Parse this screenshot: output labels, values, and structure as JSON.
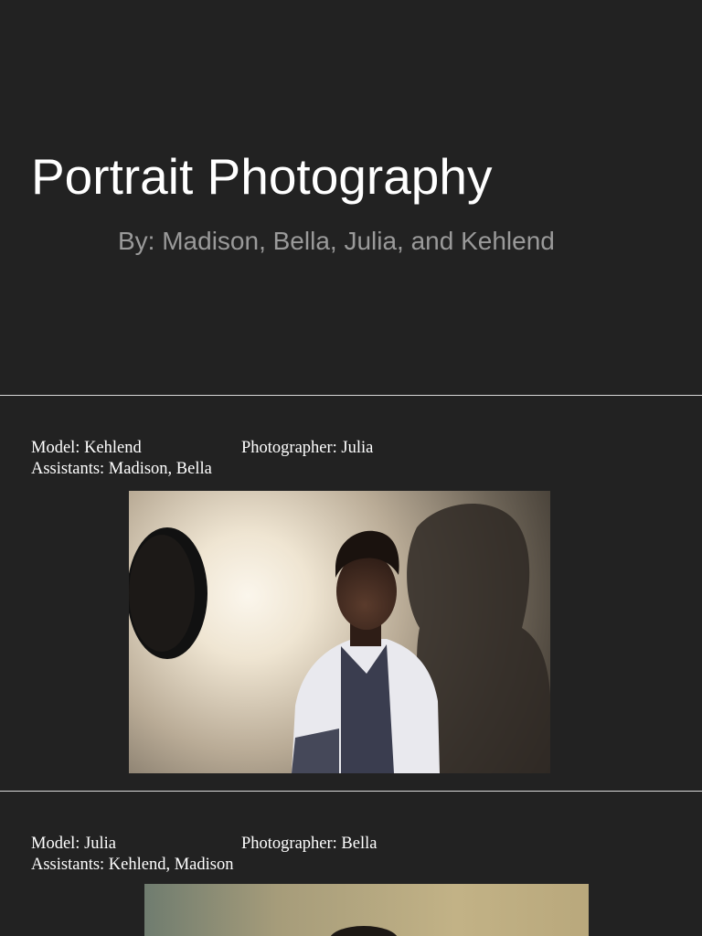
{
  "slide1": {
    "title": "Portrait Photography",
    "subtitle": "By: Madison, Bella, Julia, and Kehlend"
  },
  "slide2": {
    "model": "Model: Kehlend",
    "photographer": "Photographer: Julia",
    "assistants": "Assistants: Madison, Bella"
  },
  "slide3": {
    "model": "Model: Julia",
    "photographer": "Photographer: Bella",
    "assistants": "Assistants: Kehlend, Madison"
  },
  "colors": {
    "background": "#222222",
    "title": "#ffffff",
    "subtitle": "#9a9a9a",
    "divider": "#d9d9d9"
  }
}
